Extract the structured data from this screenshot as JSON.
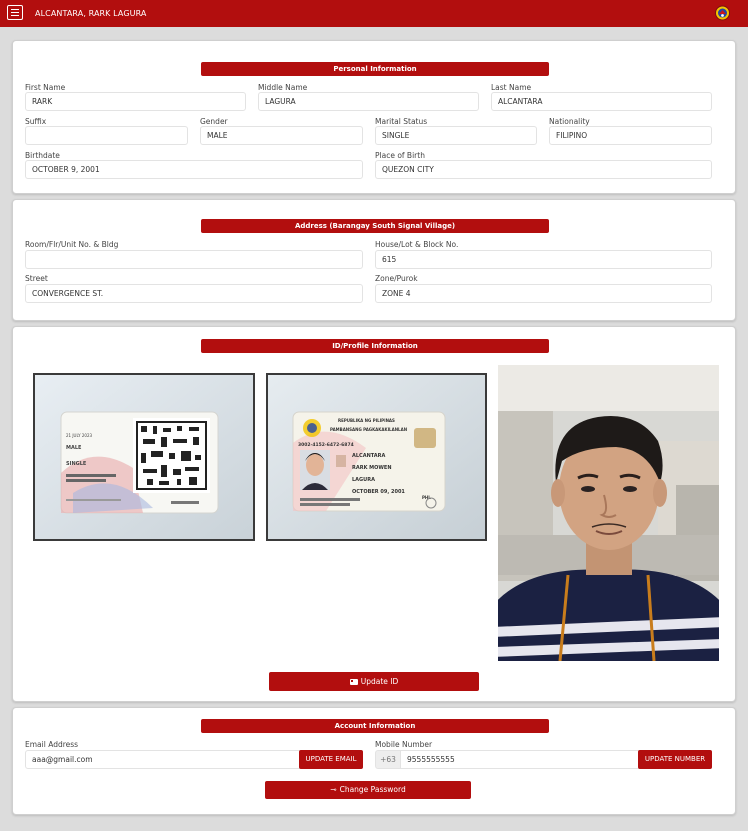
{
  "header": {
    "user_name": "ALCANTARA, RARK LAGURA"
  },
  "personal": {
    "title": "Personal Information",
    "first_name_label": "First Name",
    "first_name": "RARK",
    "middle_name_label": "Middle Name",
    "middle_name": "LAGURA",
    "last_name_label": "Last Name",
    "last_name": "ALCANTARA",
    "suffix_label": "Suffix",
    "suffix": "",
    "gender_label": "Gender",
    "gender": "MALE",
    "marital_label": "Marital Status",
    "marital": "SINGLE",
    "nationality_label": "Nationality",
    "nationality": "FILIPINO",
    "birthdate_label": "Birthdate",
    "birthdate": "OCTOBER 9, 2001",
    "birthplace_label": "Place of Birth",
    "birthplace": "QUEZON CITY"
  },
  "address": {
    "title": "Address (Barangay South Signal Village)",
    "room_label": "Room/Flr/Unit No. & Bldg",
    "room": "",
    "house_label": "House/Lot & Block No.",
    "house": "615",
    "street_label": "Street",
    "street": "CONVERGENCE ST.",
    "zone_label": "Zone/Purok",
    "zone": "ZONE 4"
  },
  "id_profile": {
    "title": "ID/Profile Information",
    "update_id_label": "Update ID",
    "id_back": {
      "date": "21 JULY 2023",
      "sex": "MALE",
      "status": "SINGLE",
      "address": "CITY OF LAS PIÑAS, NCR, FOURTH DISTRICT"
    },
    "id_front": {
      "country": "REPUBLIKA NG PILIPINAS",
      "card_name": "PAMBANSANG PAGKAKAKILANLAN",
      "number": "3002-4152-6472-6874",
      "last_name": "ALCANTARA",
      "first_name": "RARK MOWEN",
      "middle_name": "LAGURA",
      "dob": "OCTOBER 09, 2001",
      "code": "PHL"
    }
  },
  "account": {
    "title": "Account Information",
    "email_label": "Email Address",
    "email": "aaa@gmail.com",
    "update_email_label": "UPDATE EMAIL",
    "mobile_label": "Mobile Number",
    "mobile_prefix": "+63",
    "mobile": "9555555555",
    "update_number_label": "UPDATE NUMBER",
    "change_password_label": "Change Password"
  },
  "colors": {
    "accent": "#b20e0e",
    "background": "#dcdcdc"
  }
}
